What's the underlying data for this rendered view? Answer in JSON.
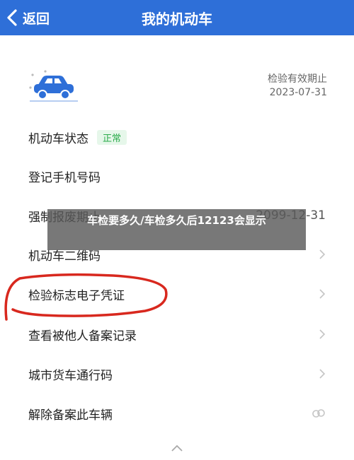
{
  "header": {
    "back_label": "返回",
    "title": "我的机动车"
  },
  "vehicle": {
    "icon": "car-icon",
    "valid_label": "检验有效期止",
    "valid_date": "2023-07-31"
  },
  "rows": [
    {
      "label": "机动车状态",
      "badge": "正常"
    },
    {
      "label": "登记手机号码"
    },
    {
      "label": "强制报废期止",
      "date": "2099-12-31"
    },
    {
      "label": "机动车二维码"
    },
    {
      "label": "检验标志电子凭证"
    },
    {
      "label": "查看被他人备案记录"
    },
    {
      "label": "城市货车通行码"
    },
    {
      "label": "解除备案此车辆"
    }
  ],
  "overlay": {
    "text": "车检要多久/车检多久后12123会显示"
  },
  "colors": {
    "header_bg": "#2e6fd8",
    "badge_text": "#2bab4b",
    "annotation": "#d8281e"
  }
}
